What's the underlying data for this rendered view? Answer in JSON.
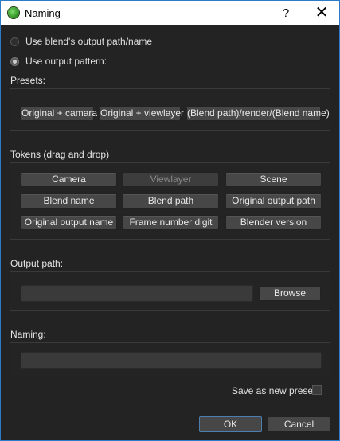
{
  "window": {
    "title": "Naming",
    "help": "?",
    "close": "✕"
  },
  "options": {
    "blend_output": "Use blend's output path/name",
    "output_pattern": "Use output pattern:"
  },
  "presets": {
    "label": "Presets:",
    "items": [
      "Original + camara",
      "Original + viewlayer",
      "(Blend path)/render/(Blend name)"
    ]
  },
  "tokens": {
    "label": "Tokens (drag and drop)",
    "items": [
      "Camera",
      "Viewlayer",
      "Scene",
      "Blend name",
      "Blend path",
      "Original output path",
      "Original output name",
      "Frame number digit",
      "Blender version"
    ]
  },
  "output_path": {
    "label": "Output path:",
    "value": "",
    "browse": "Browse"
  },
  "naming": {
    "label": "Naming:",
    "value": ""
  },
  "save_preset": {
    "label": "Save as new preset",
    "checked": false
  },
  "dialog": {
    "ok": "OK",
    "cancel": "Cancel"
  }
}
